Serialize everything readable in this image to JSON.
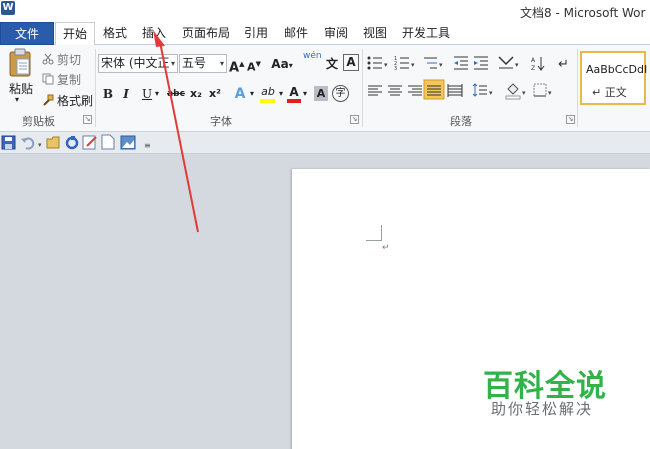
{
  "window": {
    "app_icon": "W",
    "title": "文档8 - Microsoft Wor"
  },
  "tabs": [
    {
      "label": "文件"
    },
    {
      "label": "开始"
    },
    {
      "label": "格式"
    },
    {
      "label": "插入"
    },
    {
      "label": "页面布局"
    },
    {
      "label": "引用"
    },
    {
      "label": "邮件"
    },
    {
      "label": "审阅"
    },
    {
      "label": "视图"
    },
    {
      "label": "开发工具"
    }
  ],
  "clipboard": {
    "paste_label": "粘贴",
    "cut_label": "剪切",
    "copy_label": "复制",
    "format_painter_label": "格式刷",
    "group_label": "剪贴板"
  },
  "font": {
    "font_name": "宋体 (中文正",
    "font_size": "五号",
    "grow_label": "A",
    "shrink_label": "A",
    "case_label": "Aa",
    "bold": "B",
    "italic": "I",
    "underline": "U",
    "strike": "abc",
    "subscript": "x₂",
    "superscript": "x²",
    "effects": "A",
    "highlight": "ab",
    "font_color": "A",
    "shading": "A",
    "enclose": "字",
    "phonetic": "wén",
    "phonetic_char": "文",
    "border_char": "A",
    "group_label": "字体"
  },
  "paragraph": {
    "group_label": "段落"
  },
  "styles": {
    "sample": "AaBbCcDdI",
    "name": "↵ 正文"
  },
  "document": {
    "para_mark": "↵"
  },
  "watermark": {
    "title": "百科全说",
    "subtitle": "助你轻松解决"
  },
  "colors": {
    "file_tab": "#2a5cab",
    "watermark_green": "#32b34a",
    "arrow_red": "#e23a3a",
    "highlight_yellow": "#ffff00",
    "font_red": "#e02020"
  },
  "icons": {
    "paste": "clipboard-icon",
    "cut": "scissors-icon",
    "copy": "copy-icon",
    "format_painter": "brush-icon",
    "qat_save": "save-icon",
    "qat_undo": "undo-icon",
    "qat_open": "open-folder-icon",
    "qat_refresh": "refresh-icon",
    "qat_edit": "edit-icon",
    "qat_new": "new-document-icon",
    "qat_picture": "picture-icon"
  }
}
